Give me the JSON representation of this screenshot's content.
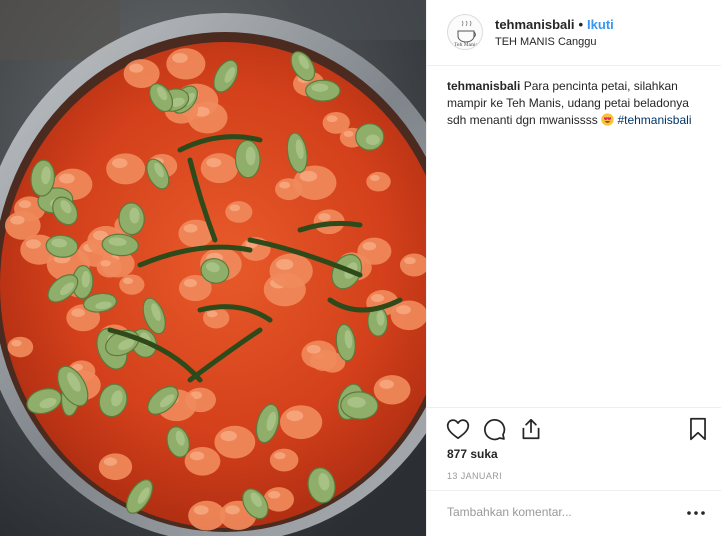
{
  "header": {
    "username": "tehmanisbali",
    "separator": "•",
    "follow_label": "Ikuti",
    "location": "TEH MANIS Canggu",
    "avatar_text": "Teh Manis"
  },
  "caption": {
    "username": "tehmanisbali",
    "text": "Para pencinta petai, silahkan mampir ke Teh Manis, udang petai beladonya sdh menanti dgn mwanissss",
    "emoji": "heart-eyes-emoji",
    "hashtag": "#tehmanisbali"
  },
  "actions": {
    "like_icon": "heart-icon",
    "comment_icon": "comment-icon",
    "share_icon": "share-icon",
    "save_icon": "bookmark-icon"
  },
  "likes": "877 suka",
  "date": "13 JANUARI",
  "comment": {
    "placeholder": "Tambahkan komentar...",
    "more_icon": "more-options-icon"
  },
  "photo": {
    "subject": "food-photo",
    "colors": {
      "sauce": "#d8421c",
      "shrimp": "#f08a5b",
      "petai": "#8fae6a",
      "leaf": "#2e4a1a"
    }
  }
}
